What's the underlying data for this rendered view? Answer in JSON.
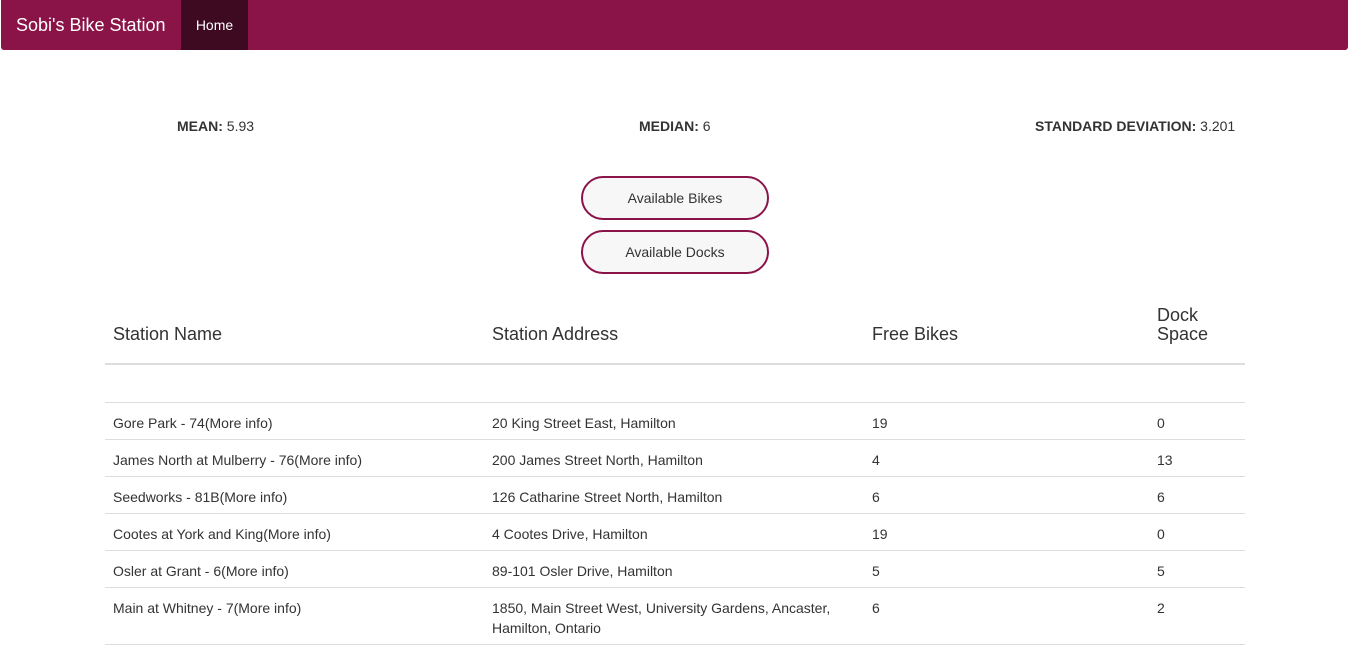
{
  "nav": {
    "brand": "Sobi's Bike Station",
    "home": "Home"
  },
  "stats": {
    "mean_label": "MEAN:",
    "mean_value": "5.93",
    "median_label": "MEDIAN:",
    "median_value": "6",
    "std_label": "STANDARD DEVIATION:",
    "std_value": "3.201"
  },
  "buttons": {
    "available_bikes": "Available Bikes",
    "available_docks": "Available Docks"
  },
  "table": {
    "headers": [
      "Station Name",
      "Station Address",
      "Free Bikes",
      "Dock Space"
    ],
    "more_info": "(More info)",
    "rows": [
      {
        "name": "Gore Park - 74",
        "address": "20 King Street East, Hamilton",
        "bikes": "19",
        "docks": "0"
      },
      {
        "name": "James North at Mulberry - 76",
        "address": "200 James Street North, Hamilton",
        "bikes": "4",
        "docks": "13"
      },
      {
        "name": "Seedworks - 81B",
        "address": "126 Catharine Street North, Hamilton",
        "bikes": "6",
        "docks": "6"
      },
      {
        "name": "Cootes at York and King",
        "address": "4 Cootes Drive, Hamilton",
        "bikes": "19",
        "docks": "0"
      },
      {
        "name": "Osler at Grant - 6",
        "address": "89-101 Osler Drive, Hamilton",
        "bikes": "5",
        "docks": "5"
      },
      {
        "name": "Main at Whitney - 7",
        "address": "1850, Main Street West, University Gardens, Ancaster, Hamilton, Ontario",
        "bikes": "6",
        "docks": "2"
      }
    ]
  },
  "colors": {
    "brand": "#8a1348",
    "nav_active": "#3d0a21"
  }
}
